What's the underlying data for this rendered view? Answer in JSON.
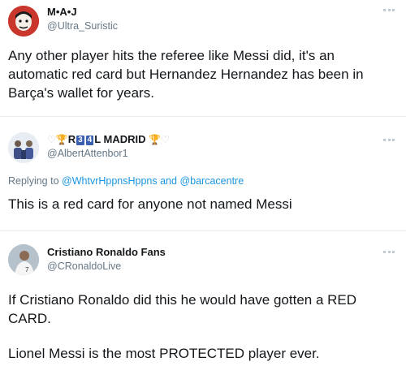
{
  "tweets": [
    {
      "display_name": "M•A•J",
      "handle": "@Ultra_Suristic",
      "avatar_icon": "cartoon-avatar-icon",
      "text": "Any other player hits the referee like Messi did, it's an automatic red card but Hernandez Hernandez has been in Barça's wallet for years."
    },
    {
      "display_name_prefix": "R",
      "score_a": "3",
      "score_b": "4",
      "display_name_suffix": "L MADRID",
      "handle": "@AlbertAttenbor1",
      "avatar_icon": "team-photo-avatar-icon",
      "reply_prefix": "Replying to",
      "reply_to_1": "@WhtvrHppnsHppns",
      "reply_and": "and",
      "reply_to_2": "@barcacentre",
      "text": "This is a red card for anyone not named Messi"
    },
    {
      "display_name": "Cristiano Ronaldo Fans",
      "handle": "@CRonaldoLive",
      "avatar_icon": "player-photo-avatar-icon",
      "text_1": "If Cristiano Ronaldo did this he would have gotten a RED CARD.",
      "text_2": "Lionel Messi is the most PROTECTED player ever."
    }
  ],
  "colors": {
    "link": "#1b95e0",
    "secondary_text": "#657786",
    "divider": "#e6ecf0",
    "badge": "#3b5fb0"
  }
}
